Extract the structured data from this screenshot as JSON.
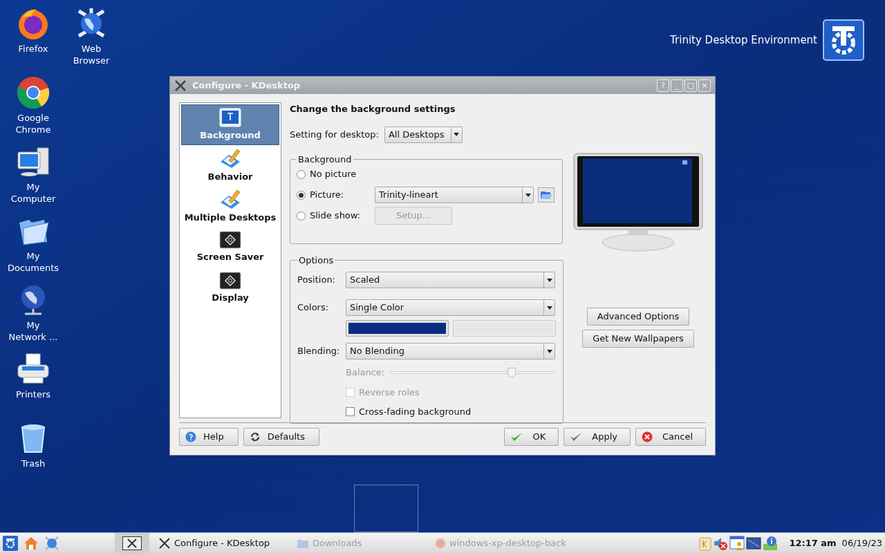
{
  "desktop": {
    "branding": "Trinity Desktop Environment",
    "icons": [
      {
        "kind": "firefox",
        "label": "Firefox"
      },
      {
        "kind": "globe-gear",
        "label": "Web Browser"
      },
      {
        "kind": "chrome",
        "label": "Google Chrome"
      },
      {
        "kind": "computer",
        "label": "My Computer"
      },
      {
        "kind": "folder",
        "label": "My Documents"
      },
      {
        "kind": "network",
        "label": "My Network ..."
      },
      {
        "kind": "printer",
        "label": "Printers"
      },
      {
        "kind": "trash",
        "label": "Trash"
      }
    ]
  },
  "window": {
    "title": "Configure - KDesktop",
    "title_buttons": [
      "?",
      "_",
      "□",
      "×"
    ],
    "sidebar": {
      "items": [
        {
          "kind": "monitor",
          "label": "Background",
          "selected": true
        },
        {
          "kind": "pencil",
          "label": "Behavior",
          "selected": false
        },
        {
          "kind": "pencil",
          "label": "Multiple Desktops",
          "selected": false
        },
        {
          "kind": "screen",
          "label": "Screen Saver",
          "selected": false
        },
        {
          "kind": "screen",
          "label": "Display",
          "selected": false
        }
      ]
    },
    "heading": "Change the background settings",
    "desktop_setting": {
      "label": "Setting for desktop:",
      "value": "All Desktops"
    },
    "background_group": {
      "title": "Background",
      "options": [
        {
          "label": "No picture",
          "selected": false
        },
        {
          "label": "Picture:",
          "selected": true,
          "kind": "combo",
          "value": "Trinity-lineart"
        },
        {
          "label": "Slide show:",
          "selected": false,
          "kind": "button",
          "value": "Setup...",
          "disabled": true
        }
      ]
    },
    "options_group": {
      "title": "Options",
      "position": {
        "label": "Position:",
        "value": "Scaled"
      },
      "colors": {
        "label": "Colors:",
        "value": "Single Color",
        "swatches": [
          {
            "color": "#0a2d82",
            "disabled": false
          },
          {
            "color": "#e6e6e6",
            "disabled": true
          }
        ]
      },
      "blending": {
        "label": "Blending:",
        "value": "No Blending"
      },
      "balance": {
        "label": "Balance:",
        "level": 0.74,
        "disabled": true
      },
      "checkboxes": [
        {
          "label": "Reverse roles",
          "checked": false,
          "disabled": true
        },
        {
          "label": "Cross-fading background",
          "checked": false,
          "disabled": false
        }
      ]
    },
    "side_buttons": [
      "Advanced Options",
      "Get New Wallpapers"
    ],
    "buttons_left": [
      {
        "kind": "help",
        "label": "Help"
      },
      {
        "kind": "defaults",
        "label": "Defaults"
      }
    ],
    "buttons_right": [
      {
        "kind": "ok",
        "label": "OK"
      },
      {
        "kind": "apply",
        "label": "Apply"
      },
      {
        "kind": "cancel",
        "label": "Cancel"
      }
    ]
  },
  "taskbar": {
    "tasks": [
      {
        "kind": "x",
        "label": "Configure - KDesktop",
        "minimized": false
      },
      {
        "kind": "folder",
        "label": "Downloads",
        "minimized": true
      },
      {
        "kind": "firefox",
        "label": "windows-xp-desktop-back",
        "minimized": true
      }
    ],
    "time": "12:17 am",
    "date": "06/19/23"
  }
}
